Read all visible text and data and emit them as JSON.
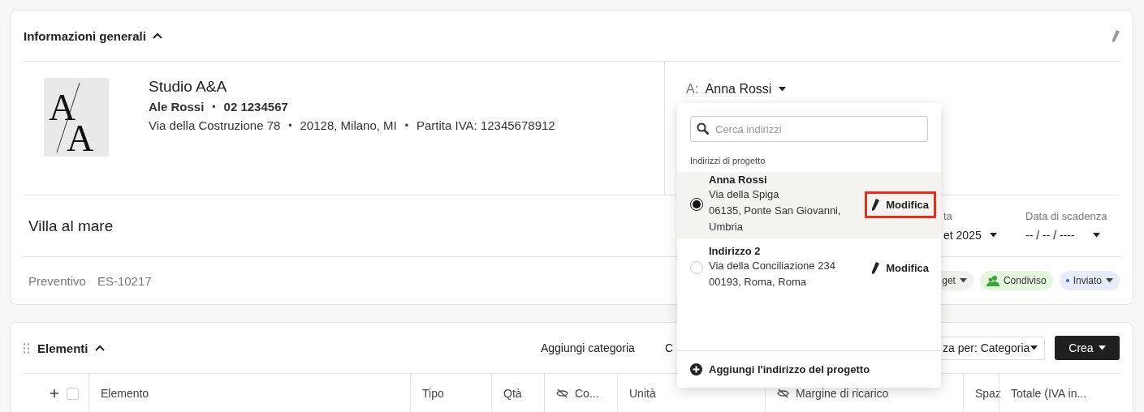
{
  "general": {
    "title": "Informazioni generali",
    "expanded": true
  },
  "logo": {
    "letters": [
      "A",
      "A"
    ]
  },
  "company": {
    "separator": "•",
    "name": "Studio A&A",
    "contact": "Ale Rossi",
    "phone": "02 1234567",
    "address": "Via della Costruzione 78",
    "city": "20128, Milano, MI",
    "vat": "Partita IVA: 12345678912"
  },
  "recipient": {
    "prefix": "A:",
    "name": "Anna Rossi"
  },
  "project": {
    "title": "Villa al mare"
  },
  "dates": [
    {
      "label": "ta",
      "value": "et 2025"
    },
    {
      "label": "Data di scadenza",
      "value": "-- / -- / ----"
    }
  ],
  "document": {
    "label": "Preventivo",
    "number": "ES-10217"
  },
  "chips": [
    {
      "kind": "dropdown",
      "label": "get"
    },
    {
      "kind": "shared",
      "label": "Condiviso"
    },
    {
      "kind": "status",
      "label": "Inviato",
      "color": "#3b5bdb"
    }
  ],
  "elements": {
    "title": "Elementi",
    "expanded": true,
    "actions": [
      "Aggiungi categoria",
      "C"
    ],
    "group_by": "za per: Categoria",
    "create": "Crea"
  },
  "select_all": {
    "checked": false
  },
  "columns": [
    {
      "label": "Elemento",
      "hidden": false
    },
    {
      "label": "Tipo",
      "hidden": false
    },
    {
      "label": "Qtà",
      "hidden": false
    },
    {
      "label": "Co...",
      "hidden": true
    },
    {
      "label": "Unità",
      "hidden": false
    },
    {
      "label": "Margine di ricarico",
      "hidden": true
    },
    {
      "label": "Spaz",
      "hidden": false
    },
    {
      "label": "Totale (IVA in...",
      "hidden": false
    }
  ],
  "address_menu": {
    "placeholder": "Cerca indirizzi",
    "section": "Indirizzi di progetto",
    "items": [
      {
        "name": "Anna Rossi",
        "lines": [
          "Via della Spiga",
          "06135, Ponte San Giovanni,",
          "Umbria"
        ],
        "selected": true,
        "action": "Modifica",
        "highlighted": true
      },
      {
        "name": "Indirizzo 2",
        "lines": [
          "Via della Conciliazione 234",
          "00193, Roma, Roma"
        ],
        "selected": false,
        "action": "Modifica",
        "highlighted": false
      }
    ],
    "add": "Aggiungi l'indirizzo del progetto"
  }
}
